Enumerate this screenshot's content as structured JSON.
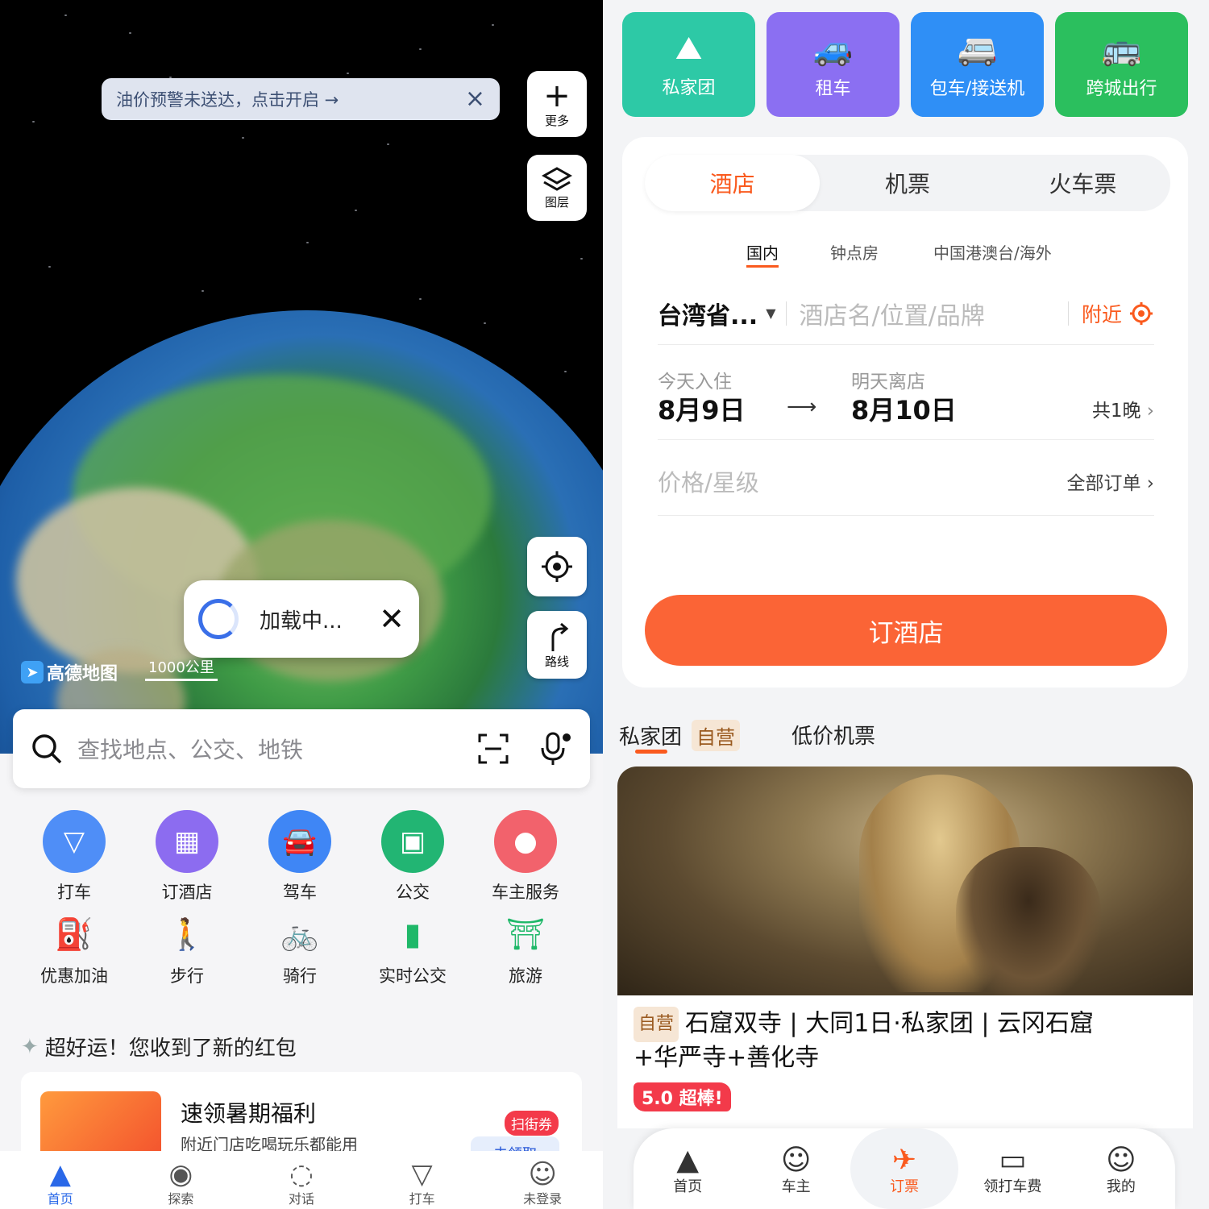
{
  "left": {
    "alert": {
      "text": "油价预警未送达，点击开启 →"
    },
    "map_buttons": {
      "more": "更多",
      "layers": "图层",
      "route": "路线"
    },
    "loading": "加载中...",
    "map_logo": "高德地图",
    "scale": "1000公里",
    "search": {
      "placeholder": "查找地点、公交、地铁"
    },
    "services_row1": [
      {
        "label": "打车",
        "icon": "taxi-icon",
        "color": "#4f8ef7"
      },
      {
        "label": "订酒店",
        "icon": "hotel-icon",
        "color": "#8c6cf0"
      },
      {
        "label": "驾车",
        "icon": "car-icon",
        "color": "#3f86f5"
      },
      {
        "label": "公交",
        "icon": "bus-icon",
        "color": "#22b573"
      },
      {
        "label": "车主服务",
        "icon": "driver-icon",
        "color": "#f2626c"
      }
    ],
    "services_row2": [
      {
        "label": "优惠加油",
        "icon": "gas-icon",
        "color": "#f2505c"
      },
      {
        "label": "步行",
        "icon": "walk-icon",
        "color": "#1fb869"
      },
      {
        "label": "骑行",
        "icon": "bike-icon",
        "color": "#1fb869"
      },
      {
        "label": "实时公交",
        "icon": "realtime-bus-icon",
        "color": "#1fb869"
      },
      {
        "label": "旅游",
        "icon": "travel-icon",
        "color": "#1fb869"
      }
    ],
    "promo": {
      "title": "超好运！您收到了新的红包",
      "card_title": "速领暑期福利",
      "card_desc": "附近门店吃喝玩乐都能用",
      "badge": "扫街券",
      "sub_button": "去领取"
    },
    "nav": [
      {
        "label": "首页",
        "icon": "home-nav-icon",
        "active": true
      },
      {
        "label": "探索",
        "icon": "explore-nav-icon"
      },
      {
        "label": "对话",
        "icon": "chat-nav-icon"
      },
      {
        "label": "打车",
        "icon": "taxi-nav-icon"
      },
      {
        "label": "未登录",
        "icon": "user-nav-icon"
      }
    ]
  },
  "right": {
    "tiles": [
      {
        "label": "私家团",
        "color": "#2dc9a6",
        "icon": "mountain-icon"
      },
      {
        "label": "租车",
        "color": "#8b6ff2",
        "icon": "rent-car-icon"
      },
      {
        "label": "包车/接送机",
        "color": "#2f8ff6",
        "icon": "charter-car-icon"
      },
      {
        "label": "跨城出行",
        "color": "#2bbf5e",
        "icon": "intercity-bus-icon"
      }
    ],
    "tabs": [
      "酒店",
      "机票",
      "火车票"
    ],
    "subtabs": [
      "国内",
      "钟点房",
      "中国港澳台/海外"
    ],
    "city": "台湾省...",
    "search_placeholder": "酒店名/位置/品牌",
    "nearby": "附近",
    "checkin_label": "今天入住",
    "checkin_date": "8月9日",
    "checkout_label": "明天离店",
    "checkout_date": "8月10日",
    "nights": "共1晚",
    "price_label": "价格/星级",
    "all_orders": "全部订单",
    "book_button": "订酒店",
    "section_tab1": "私家团",
    "section_badge": "自营",
    "section_tab2": "低价机票",
    "feature": {
      "tag": "自营",
      "title_line1": "石窟双寺 | 大同1日·私家团 | 云冈石窟",
      "title_line2": "+华严寺+善化寺",
      "rating": "5.0 超棒!"
    },
    "nav": [
      {
        "label": "首页",
        "icon": "home-nav-icon"
      },
      {
        "label": "车主",
        "icon": "driver-nav-icon"
      },
      {
        "label": "订票",
        "icon": "ticket-nav-icon",
        "active": true
      },
      {
        "label": "领打车费",
        "icon": "coupon-nav-icon"
      },
      {
        "label": "我的",
        "icon": "profile-nav-icon"
      }
    ],
    "accent": "#fa5a1e"
  }
}
